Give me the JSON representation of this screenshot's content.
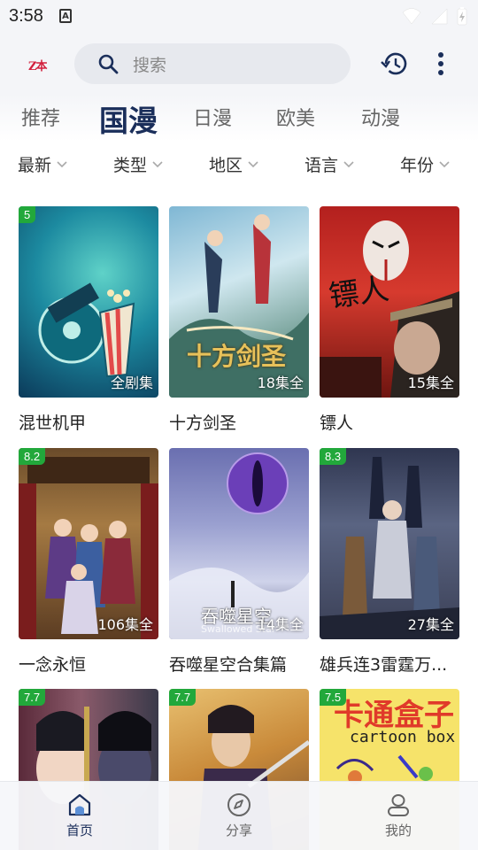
{
  "status": {
    "time": "3:58",
    "notification_glyph": "A"
  },
  "app": {
    "logo_text": "Z本"
  },
  "search": {
    "placeholder": "搜索"
  },
  "tabs": [
    {
      "label": "推荐",
      "active": false
    },
    {
      "label": "国漫",
      "active": true
    },
    {
      "label": "日漫",
      "active": false
    },
    {
      "label": "欧美",
      "active": false
    },
    {
      "label": "动漫",
      "active": false
    }
  ],
  "filters": [
    "最新",
    "类型",
    "地区",
    "语言",
    "年份"
  ],
  "cards": [
    {
      "title": "混世机甲",
      "score": "5",
      "episodes": "全剧集"
    },
    {
      "title": "十方剑圣",
      "score": "",
      "episodes": "18集全"
    },
    {
      "title": "镖人",
      "score": "",
      "episodes": "15集全"
    },
    {
      "title": "一念永恒",
      "score": "8.2",
      "episodes": "106集全"
    },
    {
      "title": "吞噬星空合集篇",
      "score": "",
      "episodes": "14集全"
    },
    {
      "title": "雄兵连3雷霆万...",
      "score": "8.3",
      "episodes": "27集全"
    },
    {
      "title": "",
      "score": "7.7",
      "episodes": ""
    },
    {
      "title": "",
      "score": "7.7",
      "episodes": ""
    },
    {
      "title": "",
      "score": "7.5",
      "episodes": ""
    }
  ],
  "poster_text": {
    "card3": "镖人",
    "card5_title": "吞噬星空",
    "card5_sub": "Swallowed Star",
    "card9_title": "卡通盒子",
    "card9_sub": "cartoon box"
  },
  "nav": [
    {
      "label": "首页",
      "icon": "home-icon",
      "active": true
    },
    {
      "label": "分享",
      "icon": "compass-icon",
      "active": false
    },
    {
      "label": "我的",
      "icon": "user-icon",
      "active": false
    }
  ],
  "colors": {
    "accent": "#1a2e5a",
    "score_badge": "#22a83b",
    "header_bg": "#f4f5f8",
    "search_bg": "#e7e9ee"
  }
}
